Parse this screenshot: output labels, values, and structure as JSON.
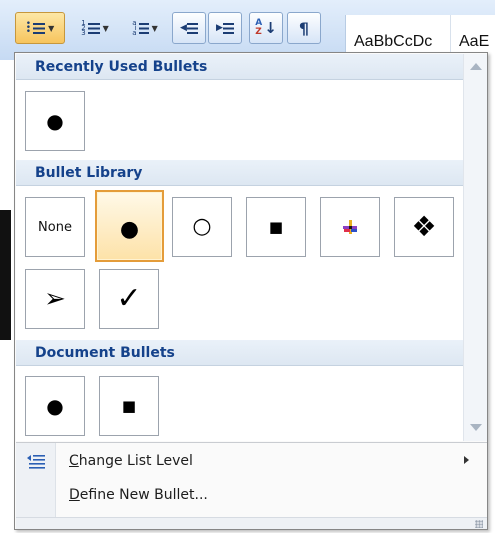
{
  "ribbon": {
    "buttons": [
      {
        "name": "bullets-button",
        "icon": "bulleted-list-icon",
        "caret": true,
        "active": true
      },
      {
        "name": "numbering-button",
        "icon": "numbered-list-icon",
        "caret": true,
        "active": false
      },
      {
        "name": "multilevel-list-button",
        "icon": "multilevel-list-icon",
        "caret": true,
        "active": false
      },
      {
        "name": "decrease-indent-button",
        "icon": "decrease-indent-icon",
        "caret": false,
        "active": false
      },
      {
        "name": "increase-indent-button",
        "icon": "increase-indent-icon",
        "caret": false,
        "active": false
      },
      {
        "name": "sort-button",
        "icon": "sort-az-icon",
        "caret": false,
        "active": false
      },
      {
        "name": "show-formatting-button",
        "icon": "pilcrow-icon",
        "glyph": "¶",
        "caret": false,
        "active": false
      }
    ],
    "styles": [
      "AaBbCcDc",
      "AaE"
    ]
  },
  "menu": {
    "sections": [
      {
        "title": "Recently Used Bullets",
        "items": [
          {
            "glyph": "●",
            "icon": "filled-circle-bullet"
          }
        ]
      },
      {
        "title": "Bullet Library",
        "items": [
          {
            "label": "None"
          },
          {
            "glyph": "●",
            "icon": "filled-circle-bullet",
            "selected": true
          },
          {
            "glyph": "○",
            "icon": "hollow-circle-bullet"
          },
          {
            "glyph": "■",
            "icon": "filled-square-bullet"
          },
          {
            "icon": "four-color-diamond-bullet"
          },
          {
            "glyph": "❖",
            "icon": "diamond-cluster-bullet"
          },
          {
            "glyph": "➢",
            "icon": "arrowhead-bullet"
          },
          {
            "glyph": "✓",
            "icon": "checkmark-bullet"
          }
        ]
      },
      {
        "title": "Document Bullets",
        "items": [
          {
            "glyph": "●",
            "icon": "filled-circle-bullet"
          },
          {
            "glyph": "■",
            "icon": "filled-square-bullet"
          }
        ]
      }
    ],
    "commands": [
      {
        "label": "Change List Level",
        "underline": "C",
        "icon": "change-list-level-icon",
        "has_submenu": true
      },
      {
        "label": "Define New Bullet...",
        "underline": "D"
      }
    ]
  },
  "colors": {
    "selected_border": "#e49c3a",
    "header_text": "#15428b",
    "header_bg": "#dde7f2"
  }
}
